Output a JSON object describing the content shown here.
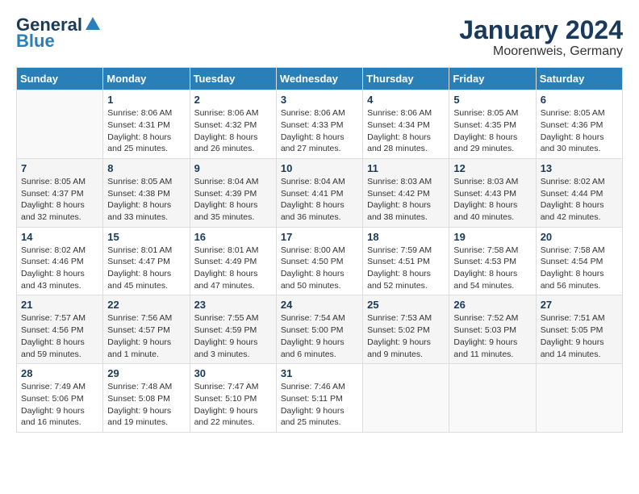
{
  "header": {
    "logo_line1": "General",
    "logo_line2": "Blue",
    "title": "January 2024",
    "subtitle": "Moorenweis, Germany"
  },
  "calendar": {
    "days_of_week": [
      "Sunday",
      "Monday",
      "Tuesday",
      "Wednesday",
      "Thursday",
      "Friday",
      "Saturday"
    ],
    "weeks": [
      [
        {
          "day": "",
          "info": ""
        },
        {
          "day": "1",
          "info": "Sunrise: 8:06 AM\nSunset: 4:31 PM\nDaylight: 8 hours\nand 25 minutes."
        },
        {
          "day": "2",
          "info": "Sunrise: 8:06 AM\nSunset: 4:32 PM\nDaylight: 8 hours\nand 26 minutes."
        },
        {
          "day": "3",
          "info": "Sunrise: 8:06 AM\nSunset: 4:33 PM\nDaylight: 8 hours\nand 27 minutes."
        },
        {
          "day": "4",
          "info": "Sunrise: 8:06 AM\nSunset: 4:34 PM\nDaylight: 8 hours\nand 28 minutes."
        },
        {
          "day": "5",
          "info": "Sunrise: 8:05 AM\nSunset: 4:35 PM\nDaylight: 8 hours\nand 29 minutes."
        },
        {
          "day": "6",
          "info": "Sunrise: 8:05 AM\nSunset: 4:36 PM\nDaylight: 8 hours\nand 30 minutes."
        }
      ],
      [
        {
          "day": "7",
          "info": "Sunrise: 8:05 AM\nSunset: 4:37 PM\nDaylight: 8 hours\nand 32 minutes."
        },
        {
          "day": "8",
          "info": "Sunrise: 8:05 AM\nSunset: 4:38 PM\nDaylight: 8 hours\nand 33 minutes."
        },
        {
          "day": "9",
          "info": "Sunrise: 8:04 AM\nSunset: 4:39 PM\nDaylight: 8 hours\nand 35 minutes."
        },
        {
          "day": "10",
          "info": "Sunrise: 8:04 AM\nSunset: 4:41 PM\nDaylight: 8 hours\nand 36 minutes."
        },
        {
          "day": "11",
          "info": "Sunrise: 8:03 AM\nSunset: 4:42 PM\nDaylight: 8 hours\nand 38 minutes."
        },
        {
          "day": "12",
          "info": "Sunrise: 8:03 AM\nSunset: 4:43 PM\nDaylight: 8 hours\nand 40 minutes."
        },
        {
          "day": "13",
          "info": "Sunrise: 8:02 AM\nSunset: 4:44 PM\nDaylight: 8 hours\nand 42 minutes."
        }
      ],
      [
        {
          "day": "14",
          "info": "Sunrise: 8:02 AM\nSunset: 4:46 PM\nDaylight: 8 hours\nand 43 minutes."
        },
        {
          "day": "15",
          "info": "Sunrise: 8:01 AM\nSunset: 4:47 PM\nDaylight: 8 hours\nand 45 minutes."
        },
        {
          "day": "16",
          "info": "Sunrise: 8:01 AM\nSunset: 4:49 PM\nDaylight: 8 hours\nand 47 minutes."
        },
        {
          "day": "17",
          "info": "Sunrise: 8:00 AM\nSunset: 4:50 PM\nDaylight: 8 hours\nand 50 minutes."
        },
        {
          "day": "18",
          "info": "Sunrise: 7:59 AM\nSunset: 4:51 PM\nDaylight: 8 hours\nand 52 minutes."
        },
        {
          "day": "19",
          "info": "Sunrise: 7:58 AM\nSunset: 4:53 PM\nDaylight: 8 hours\nand 54 minutes."
        },
        {
          "day": "20",
          "info": "Sunrise: 7:58 AM\nSunset: 4:54 PM\nDaylight: 8 hours\nand 56 minutes."
        }
      ],
      [
        {
          "day": "21",
          "info": "Sunrise: 7:57 AM\nSunset: 4:56 PM\nDaylight: 8 hours\nand 59 minutes."
        },
        {
          "day": "22",
          "info": "Sunrise: 7:56 AM\nSunset: 4:57 PM\nDaylight: 9 hours\nand 1 minute."
        },
        {
          "day": "23",
          "info": "Sunrise: 7:55 AM\nSunset: 4:59 PM\nDaylight: 9 hours\nand 3 minutes."
        },
        {
          "day": "24",
          "info": "Sunrise: 7:54 AM\nSunset: 5:00 PM\nDaylight: 9 hours\nand 6 minutes."
        },
        {
          "day": "25",
          "info": "Sunrise: 7:53 AM\nSunset: 5:02 PM\nDaylight: 9 hours\nand 9 minutes."
        },
        {
          "day": "26",
          "info": "Sunrise: 7:52 AM\nSunset: 5:03 PM\nDaylight: 9 hours\nand 11 minutes."
        },
        {
          "day": "27",
          "info": "Sunrise: 7:51 AM\nSunset: 5:05 PM\nDaylight: 9 hours\nand 14 minutes."
        }
      ],
      [
        {
          "day": "28",
          "info": "Sunrise: 7:49 AM\nSunset: 5:06 PM\nDaylight: 9 hours\nand 16 minutes."
        },
        {
          "day": "29",
          "info": "Sunrise: 7:48 AM\nSunset: 5:08 PM\nDaylight: 9 hours\nand 19 minutes."
        },
        {
          "day": "30",
          "info": "Sunrise: 7:47 AM\nSunset: 5:10 PM\nDaylight: 9 hours\nand 22 minutes."
        },
        {
          "day": "31",
          "info": "Sunrise: 7:46 AM\nSunset: 5:11 PM\nDaylight: 9 hours\nand 25 minutes."
        },
        {
          "day": "",
          "info": ""
        },
        {
          "day": "",
          "info": ""
        },
        {
          "day": "",
          "info": ""
        }
      ]
    ]
  }
}
